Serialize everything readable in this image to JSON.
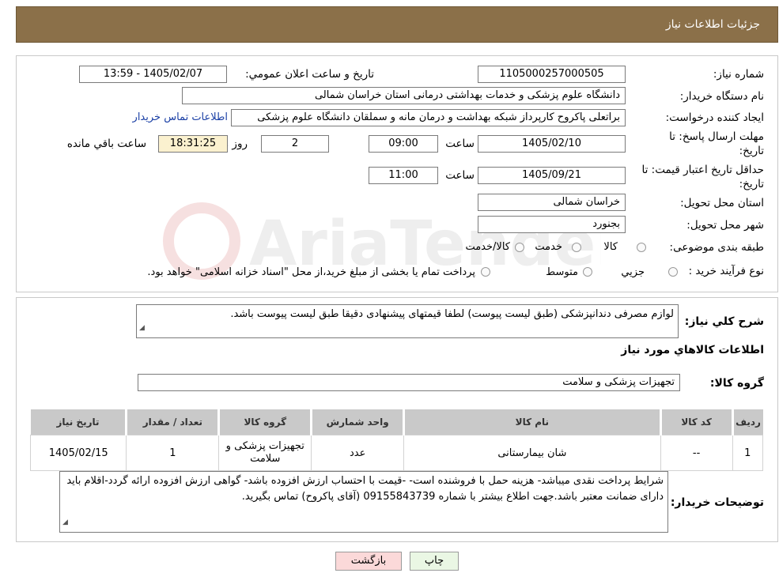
{
  "header": {
    "title": "جزئيات اطلاعات نياز"
  },
  "form": {
    "need_number_label": "شماره نياز:",
    "need_number": "1105000257000505",
    "announce_label": "تاريخ و ساعت اعلان عمومي:",
    "announce_value": "1405/02/07 - 13:59",
    "buyer_org_label": "نام دستگاه خريدار:",
    "buyer_org": "دانشگاه علوم پزشکی و خدمات بهداشتی درمانی استان خراسان شمالی",
    "requester_label": "ايجاد کننده درخواست:",
    "requester": "براتعلی پاکروح کارپرداز شبکه بهداشت و درمان مانه و سملقان دانشگاه علوم پزشکی",
    "contact_link": "اطلاعات تماس خريدار",
    "deadline_label": "مهلت ارسال پاسخ: تا تاريخ:",
    "deadline_date": "1405/02/10",
    "time_label": "ساعت",
    "deadline_time": "09:00",
    "days_value": "2",
    "days_label": "روز و",
    "remaining_time": "18:31:25",
    "remaining_label": "ساعت باقي مانده",
    "validity_label": "حداقل تاريخ اعتبار قيمت: تا تاريخ:",
    "validity_date": "1405/09/21",
    "validity_time": "11:00",
    "province_label": "استان محل تحويل:",
    "province": "خراسان شمالی",
    "city_label": "شهر محل تحويل:",
    "city": "بجنورد",
    "category_label": "طبقه بندی موضوعی:",
    "category_options": [
      "کالا",
      "خدمت",
      "کالا/خدمت"
    ],
    "process_label": "نوع فرآيند خريد :",
    "process_options": [
      "جزيي",
      "متوسط"
    ],
    "process_note": "پرداخت تمام يا بخشی از مبلغ خريد،از محل \"اسناد خزانه اسلامی\" خواهد بود."
  },
  "description": {
    "label": "شرح کلي نياز:",
    "text": "لوازم مصرفی دندانپزشکی (طبق لیست پیوست) لطفا قیمتهای پیشنهادی دقیقا طبق لیست پیوست باشد.",
    "items_title": "اطلاعات کالاهاي مورد نياز",
    "group_label": "گروه کالا:",
    "group_value": "تجهيزات پزشکی و سلامت"
  },
  "table": {
    "headers": [
      "رديف",
      "کد کالا",
      "نام کالا",
      "واحد شمارش",
      "گروه کالا",
      "تعداد / مقدار",
      "تاريخ نياز"
    ],
    "rows": [
      [
        "1",
        "--",
        "شان بيمارستانی",
        "عدد",
        "تجهيزات پزشکی و سلامت",
        "1",
        "1405/02/15"
      ]
    ]
  },
  "buyer_notes": {
    "label": "توضيحات خريدار:",
    "text": "شرایط پرداخت نقدی میباشد- هزینه حمل با فروشنده است- -قیمت با احتساب ارزش افزوده  باشد- گواهی ارزش افزوده ارائه گردد-اقلام باید دارای ضمانت معتبر باشد.جهت اطلاع بیشتر با شماره 09155843739 (آقای پاکروح) تماس بگیرید."
  },
  "buttons": {
    "print": "چاپ",
    "back": "بازگشت"
  },
  "watermark": {
    "text": "AriaTender.neT"
  },
  "colors": {
    "header_bg": "#8b7049",
    "link": "#1a3fa5",
    "remaining_bg": "#fbf1cf",
    "back_bg": "#fbd9d9",
    "print_bg": "#eaf7e4"
  }
}
